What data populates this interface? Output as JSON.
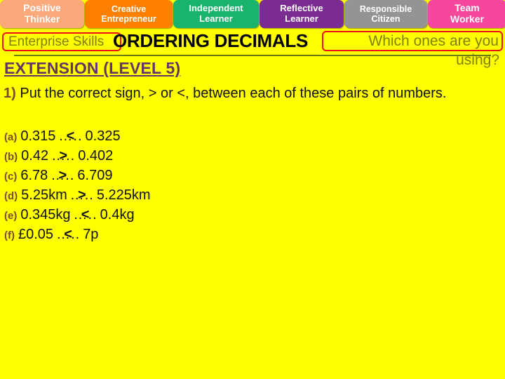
{
  "skills_banner": {
    "chips": [
      {
        "name": "positive-thinker",
        "line1": "Positive",
        "line2": "Thinker",
        "color": "#F9A97A"
      },
      {
        "name": "creative-entrepreneur",
        "line1": "Creative",
        "line2": "Entrepreneur",
        "color": "#FF8000"
      },
      {
        "name": "independent-learner",
        "line1": "Independent",
        "line2": "Learner",
        "color": "#19B36B"
      },
      {
        "name": "reflective-learner",
        "line1": "Reflective",
        "line2": "Learner",
        "color": "#7A2C92"
      },
      {
        "name": "responsible-citizen",
        "line1": "Responsible",
        "line2": "Citizen",
        "color": "#949494"
      },
      {
        "name": "team-worker",
        "line1": "Team",
        "line2": "Worker",
        "color": "#F5479B"
      }
    ]
  },
  "title_band": {
    "enterprise_skills_label": "Enterprise Skills",
    "lesson_title": "ORDERING DECIMALS",
    "which_ones_label": "Which ones are you",
    "using_label": "using?",
    "box_border_color": "#EE1111",
    "label_text_color": "#808000",
    "underline_color": "#6B7A12"
  },
  "extension": {
    "heading": "EXTENSION (LEVEL 5)",
    "color": "#663366"
  },
  "question": {
    "number": "1)",
    "text": "Put the correct sign, > or <, between each of these pairs of numbers.",
    "number_color": "#7B4A2E"
  },
  "answers": {
    "dots": "…..",
    "items": [
      {
        "label": "(a)",
        "left": "0.315",
        "sign": "<",
        "right": "0.325"
      },
      {
        "label": "(b)",
        "left": "0.42",
        "sign": ">",
        "right": "0.402"
      },
      {
        "label": "(c)",
        "left": "6.78",
        "sign": ">",
        "right": "6.709"
      },
      {
        "label": "(d)",
        "left": "5.25km",
        "sign": ">",
        "right": "5.225km"
      },
      {
        "label": "(e)",
        "left": "0.345kg",
        "sign": "<",
        "right": "0.4kg"
      },
      {
        "label": "(f)",
        "left": "£0.05",
        "sign": "<",
        "right": "7p"
      }
    ]
  },
  "page": {
    "background_color": "#FFFF00"
  }
}
